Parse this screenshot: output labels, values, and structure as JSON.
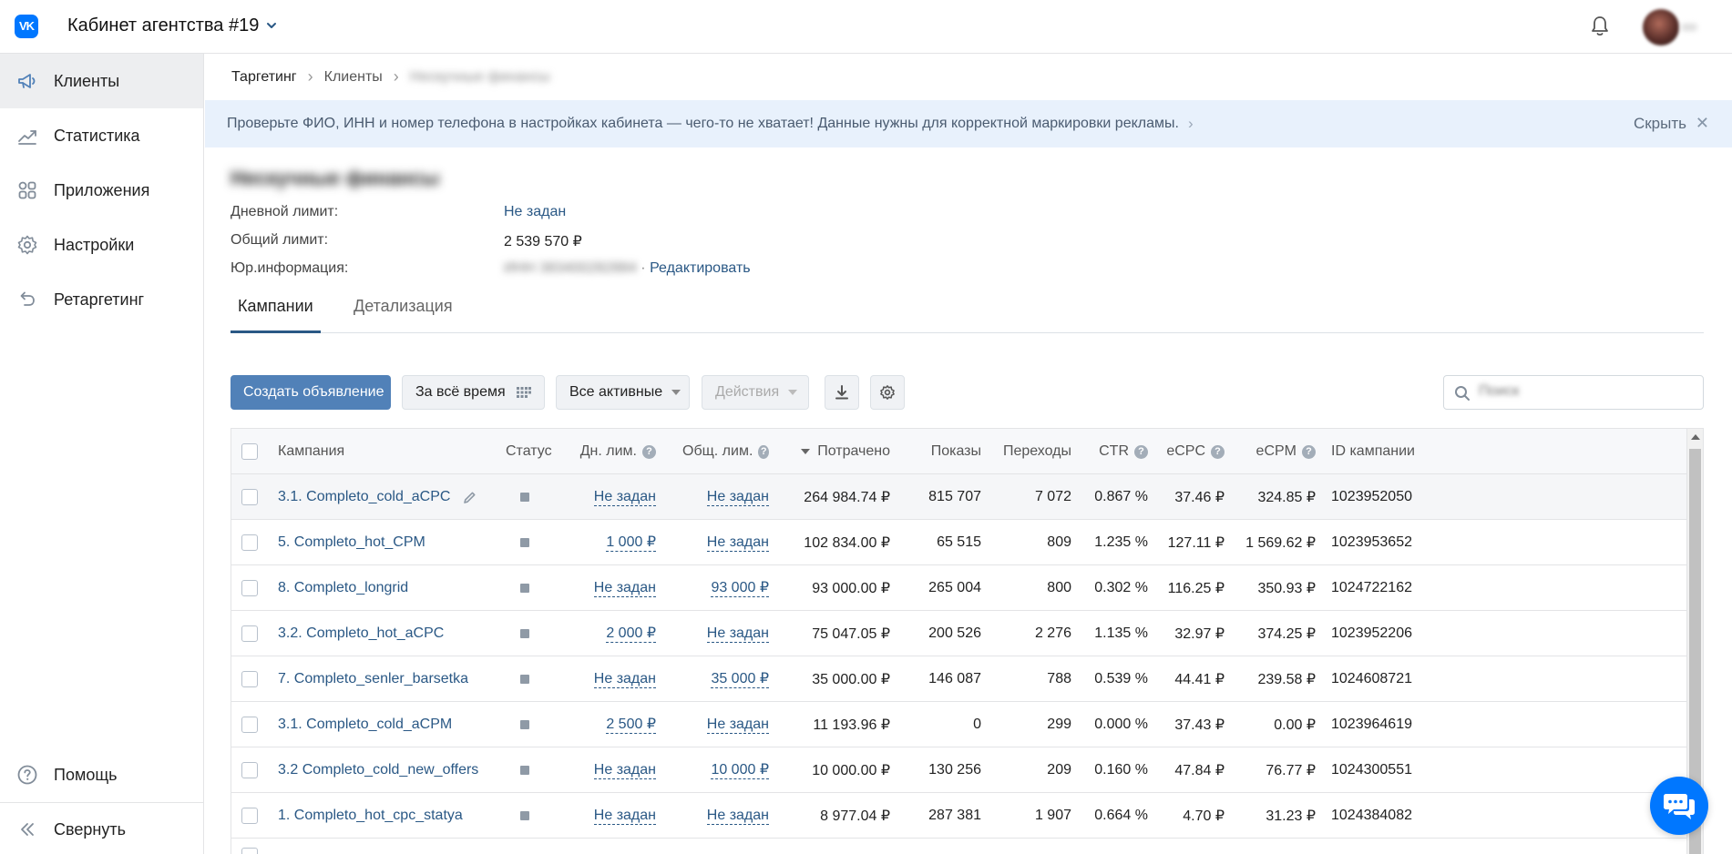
{
  "header": {
    "logo_text": "VK",
    "cabinet_title": "Кабинет агентства #19"
  },
  "sidebar": {
    "items": [
      {
        "label": "Клиенты",
        "icon": "megaphone-icon",
        "active": true
      },
      {
        "label": "Статистика",
        "icon": "chart-line-icon",
        "active": false
      },
      {
        "label": "Приложения",
        "icon": "apps-grid-icon",
        "active": false
      },
      {
        "label": "Настройки",
        "icon": "gear-icon",
        "active": false
      },
      {
        "label": "Ретаргетинг",
        "icon": "retarget-arrow-icon",
        "active": false
      }
    ],
    "help_label": "Помощь",
    "collapse_label": "Свернуть"
  },
  "breadcrumb": {
    "item1": "Таргетинг",
    "item2": "Клиенты",
    "item3": "Нескучные финансы"
  },
  "banner": {
    "text": "Проверьте ФИО, ИНН и номер телефона в настройках кабинета — чего-то не хватает! Данные нужны для корректной маркировки рекламы.",
    "hide_label": "Скрыть"
  },
  "client": {
    "name": "Нескучные финансы",
    "daily_limit_label": "Дневной лимит:",
    "daily_limit_value": "Не задан",
    "total_limit_label": "Общий лимит:",
    "total_limit_value": "2 539 570 ₽",
    "legal_label": "Юр.информация:",
    "legal_value": "ИНН 383400282884",
    "legal_sep": "·",
    "edit_label": "Редактировать"
  },
  "tabs": {
    "campaigns": "Кампании",
    "details": "Детализация"
  },
  "toolbar": {
    "create_label": "Создать объявление",
    "period_label": "За всё время",
    "filter_label": "Все активные",
    "actions_label": "Действия",
    "search_placeholder": "Поиск"
  },
  "table": {
    "headers": {
      "campaign": "Кампания",
      "status": "Статус",
      "day_limit": "Дн. лим.",
      "total_limit": "Общ. лим.",
      "spent": "Потрачено",
      "impressions": "Показы",
      "clicks": "Переходы",
      "ctr": "CTR",
      "ecpc": "eCPC",
      "ecpm": "eCPM",
      "id": "ID кампании"
    },
    "rows": [
      {
        "name": "3.1. Completo_cold_aCPC",
        "day_limit": "Не задан",
        "total_limit": "Не задан",
        "spent": "264 984.74 ₽",
        "impressions": "815 707",
        "clicks": "7 072",
        "ctr": "0.867 %",
        "ecpc": "37.46 ₽",
        "ecpm": "324.85 ₽",
        "id": "1023952050"
      },
      {
        "name": "5. Completo_hot_CPM",
        "day_limit": "1 000 ₽",
        "total_limit": "Не задан",
        "spent": "102 834.00 ₽",
        "impressions": "65 515",
        "clicks": "809",
        "ctr": "1.235 %",
        "ecpc": "127.11 ₽",
        "ecpm": "1 569.62 ₽",
        "id": "1023953652"
      },
      {
        "name": "8. Completo_longrid",
        "day_limit": "Не задан",
        "total_limit": "93 000 ₽",
        "spent": "93 000.00 ₽",
        "impressions": "265 004",
        "clicks": "800",
        "ctr": "0.302 %",
        "ecpc": "116.25 ₽",
        "ecpm": "350.93 ₽",
        "id": "1024722162"
      },
      {
        "name": "3.2. Completo_hot_aCPC",
        "day_limit": "2 000 ₽",
        "total_limit": "Не задан",
        "spent": "75 047.05 ₽",
        "impressions": "200 526",
        "clicks": "2 276",
        "ctr": "1.135 %",
        "ecpc": "32.97 ₽",
        "ecpm": "374.25 ₽",
        "id": "1023952206"
      },
      {
        "name": "7. Completo_senler_barsetka",
        "day_limit": "Не задан",
        "total_limit": "35 000 ₽",
        "spent": "35 000.00 ₽",
        "impressions": "146 087",
        "clicks": "788",
        "ctr": "0.539 %",
        "ecpc": "44.41 ₽",
        "ecpm": "239.58 ₽",
        "id": "1024608721"
      },
      {
        "name": "3.1. Completo_cold_aCPM",
        "day_limit": "2 500 ₽",
        "total_limit": "Не задан",
        "spent": "11 193.96 ₽",
        "impressions": "0",
        "clicks": "299",
        "ctr": "0.000 %",
        "ecpc": "37.43 ₽",
        "ecpm": "0.00 ₽",
        "id": "1023964619"
      },
      {
        "name": "3.2 Completo_cold_new_offers",
        "day_limit": "Не задан",
        "total_limit": "10 000 ₽",
        "spent": "10 000.00 ₽",
        "impressions": "130 256",
        "clicks": "209",
        "ctr": "0.160 %",
        "ecpc": "47.84 ₽",
        "ecpm": "76.77 ₽",
        "id": "1024300551"
      },
      {
        "name": "1. Completo_hot_cpc_statya",
        "day_limit": "Не задан",
        "total_limit": "Не задан",
        "spent": "8 977.04 ₽",
        "impressions": "287 381",
        "clicks": "1 907",
        "ctr": "0.664 %",
        "ecpc": "4.70 ₽",
        "ecpm": "31.23 ₽",
        "id": "1024384082"
      }
    ]
  },
  "colors": {
    "brand": "#0077ff",
    "link": "#2a5885",
    "primary_button": "#5181b8",
    "banner_bg": "#e8f1fc"
  }
}
